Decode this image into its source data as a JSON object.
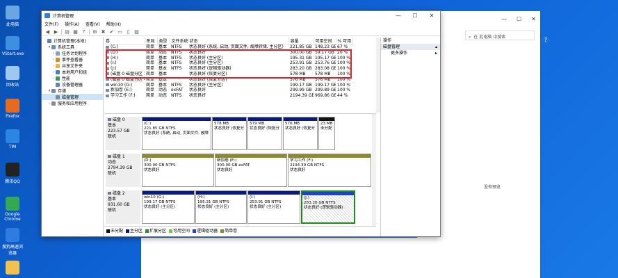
{
  "desktop": {
    "icons": [
      {
        "label": "此电脑",
        "color": "#6aa6e6"
      },
      {
        "label": "VStart.exe",
        "color": "#3d8fe0"
      },
      {
        "label": "回收站",
        "color": "#9fc7ef"
      },
      {
        "label": "Firefox",
        "color": "#e76a22"
      },
      {
        "label": "TIM",
        "color": "#2a86e2"
      },
      {
        "label": "腾讯QQ",
        "color": "#222222"
      },
      {
        "label": "Google Chrome",
        "color": "#34a853"
      },
      {
        "label": "搜狗高速浏览器",
        "color": "#2f7be0"
      },
      {
        "label": "",
        "color": "#f2c14e"
      }
    ]
  },
  "bgwindow": {
    "minimize": "—",
    "maximize": "☐",
    "close": "✕",
    "search_placeholder": "在 此电脑 中搜索",
    "empty_text": "没有预览",
    "help": "?"
  },
  "window": {
    "title": "计算机管理",
    "controls": {
      "minimize": "—",
      "maximize": "☐",
      "close": "✕"
    },
    "menu": [
      "文件(F)",
      "操作(A)",
      "查看(V)",
      "帮助(H)"
    ],
    "toolbar_icons": [
      "back-arrow-icon",
      "forward-arrow-icon",
      "up-folder-icon",
      "properties-icon",
      "help-icon",
      "connect-icon",
      "delete-icon",
      "check-icon",
      "open-folder-icon",
      "new-doc-icon",
      "view-icon"
    ],
    "toolbar_glyphs": [
      "◀",
      "▶",
      "▤",
      "▦",
      "?",
      "⊞",
      "✖",
      "✔",
      "▭",
      "▯",
      "▨"
    ]
  },
  "tree": [
    {
      "label": "计算机管理(本地)",
      "indent": 0,
      "expander": "",
      "color": "#5a7fb0"
    },
    {
      "label": "系统工具",
      "indent": 1,
      "expander": "▾",
      "color": "#6b8dbd"
    },
    {
      "label": "任务计划程序",
      "indent": 2,
      "expander": "›",
      "color": "#7fa3c8"
    },
    {
      "label": "事件查看器",
      "indent": 2,
      "expander": "›",
      "color": "#d28a2a"
    },
    {
      "label": "共享文件夹",
      "indent": 2,
      "expander": "›",
      "color": "#e3b93a"
    },
    {
      "label": "本地用户和组",
      "indent": 2,
      "expander": "›",
      "color": "#4a7fb8"
    },
    {
      "label": "性能",
      "indent": 2,
      "expander": "›",
      "color": "#3a9a5a"
    },
    {
      "label": "设备管理器",
      "indent": 2,
      "expander": "",
      "color": "#6a84b0"
    },
    {
      "label": "存储",
      "indent": 1,
      "expander": "▾",
      "color": "#7a8aa0"
    },
    {
      "label": "磁盘管理",
      "indent": 2,
      "expander": "",
      "color": "#7a8aa0",
      "selected": true
    },
    {
      "label": "服务和应用程序",
      "indent": 1,
      "expander": "›",
      "color": "#8a8a8a"
    }
  ],
  "volume_table": {
    "headers": [
      "卷",
      "布局",
      "类型",
      "文件系统",
      "状态",
      "容量",
      "可用空间",
      "% 可用"
    ],
    "rows": [
      [
        "(C:)",
        "简单",
        "基本",
        "NTFS",
        "状态良好 (系统, 启动, 页面文件, 故障转储, 主分区)",
        "221.85 GB",
        "148.23 GB",
        "67 %"
      ],
      [
        "(D:)",
        "简单",
        "动态",
        "NTFS",
        "状态良好",
        "300.00 GB",
        "59.17 GB",
        "20 %"
      ],
      [
        "(H:)",
        "简单",
        "基本",
        "NTFS",
        "状态良好 (主分区)",
        "195.31 GB",
        "195.17 GB",
        "100 %"
      ],
      [
        "(I:)",
        "简单",
        "基本",
        "NTFS",
        "状态良好 (主分区)",
        "253.91 GB",
        "253.76 GB",
        "100 %"
      ],
      [
        "(J:)",
        "简单",
        "基本",
        "NTFS",
        "状态良好 (逻辑驱动器)",
        "283.20 GB",
        "283.08 GB",
        "100 %"
      ],
      [
        "(磁盘 0 磁盘分区 3)",
        "简单",
        "基本",
        "",
        "状态良好 (恢复分区)",
        "578 MB",
        "578 MB",
        "100 %"
      ],
      [
        "(磁盘 0 磁盘分区 4)",
        "简单",
        "基本",
        "",
        "状态良好 (恢复分区)",
        "576 MB",
        "576 MB",
        "100 %"
      ],
      [
        "win10 (G:)",
        "简单",
        "基本",
        "NTFS",
        "状态良好 (主分区)",
        "199.17 GB",
        "199.17 GB",
        "100 %"
      ],
      [
        "新加卷 (E:)",
        "简单",
        "动态",
        "exFAT",
        "状态良好",
        "299.99 GB",
        "299.89 GB",
        "100 %"
      ],
      [
        "学习工作 (F:)",
        "简单",
        "动态",
        "NTFS",
        "状态良好",
        "2194.39 GB",
        "969.86 GB",
        "44 %"
      ]
    ]
  },
  "disks": [
    {
      "label": [
        "磁盘 0",
        "基本",
        "223.57 GB",
        "联机"
      ],
      "partitions": [
        {
          "lines": [
            "(C:)",
            "221.85 GB NTFS",
            "状态良好 (系统, 启动, 页面文件, 故障"
          ],
          "bar": "#0a1a7a",
          "width": 100
        },
        {
          "lines": [
            "",
            "578 MB",
            "状态良好 (恢复分"
          ],
          "bar": "#0a1a7a",
          "width": 50
        },
        {
          "lines": [
            "",
            "579 MB",
            "状态良好 (恢复分"
          ],
          "bar": "#0a1a7a",
          "width": 50
        },
        {
          "lines": [
            "",
            "576 MB",
            "状态良好 (恢复分"
          ],
          "bar": "#0a1a7a",
          "width": 50
        },
        {
          "lines": [
            "",
            "23 MB",
            "未分配"
          ],
          "bar": "#111111",
          "width": 24
        }
      ]
    },
    {
      "label": [
        "磁盘 1",
        "动态",
        "2794.39 GB",
        "联机"
      ],
      "partitions": [
        {
          "lines": [
            "(D:)",
            "300.00 GB NTFS",
            "状态良好"
          ],
          "bar": "#8a8a2a",
          "width": 104
        },
        {
          "lines": [
            "新加卷 (E:)",
            "300.00 GB exFAT",
            "状态良好"
          ],
          "bar": "#8a8a2a",
          "width": 104
        },
        {
          "lines": [
            "学习工作 (F:)",
            "2194.39 GB NTFS",
            "状态良好"
          ],
          "bar": "#8a8a2a",
          "width": 120
        }
      ]
    },
    {
      "label": [
        "磁盘 2",
        "基本",
        "931.60 GB",
        "联机"
      ],
      "partitions": [
        {
          "lines": [
            "win10 (G:)",
            "199.17 GB NTFS",
            "状态良好 (主分区)"
          ],
          "bar": "#0a1a7a",
          "width": 76
        },
        {
          "lines": [
            "(H:)",
            "195.31 GB NTFS",
            "状态良好 (主分区)"
          ],
          "bar": "#0a1a7a",
          "width": 74
        },
        {
          "lines": [
            "(I:)",
            "253.91 GB NTFS",
            "状态良好 (主分区)"
          ],
          "bar": "#0a1a7a",
          "width": 76
        },
        {
          "lines": [
            "(J:)",
            "283.20 GB NTFS",
            "状态良好 (逻辑驱动器)"
          ],
          "bar": "#1f3fcf",
          "width": 78,
          "selected": true
        }
      ]
    }
  ],
  "legend": [
    {
      "label": "未分配",
      "color": "#111111"
    },
    {
      "label": "主分区",
      "color": "#0a1a7a"
    },
    {
      "label": "扩展分区",
      "color": "#2a8a2a"
    },
    {
      "label": "可用空间",
      "color": "#7ac04a"
    },
    {
      "label": "逻辑驱动器",
      "color": "#1f3fcf"
    },
    {
      "label": "简单卷",
      "color": "#8a8a2a"
    }
  ],
  "actions": {
    "header": "操作",
    "section": "磁盘管理",
    "section_arrow": "▴",
    "items": [
      {
        "label": "更多操作",
        "arrow": "▸"
      }
    ]
  }
}
